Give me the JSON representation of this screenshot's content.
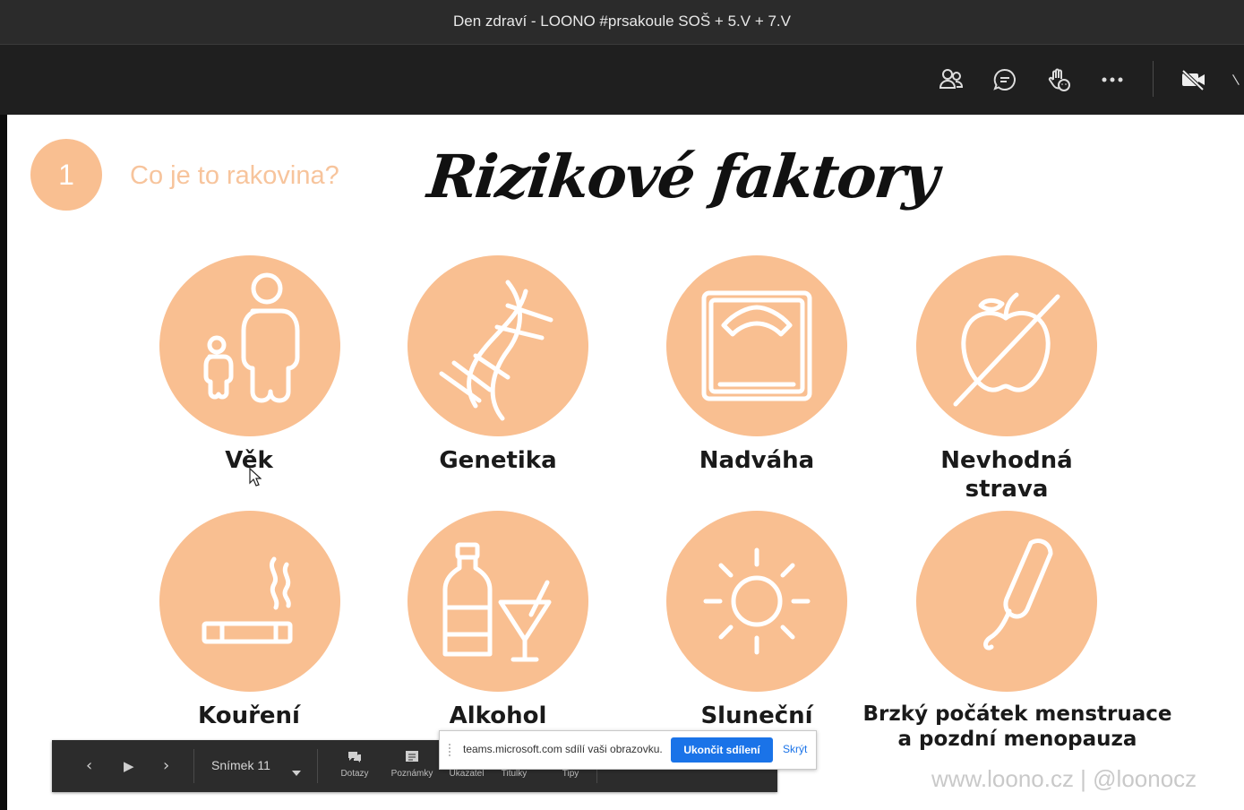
{
  "window": {
    "title": "Den zdraví - LOONO #prsakoule SOŠ + 5.V + 7.V"
  },
  "toolbar": {
    "icons": [
      "people-icon",
      "chat-icon",
      "raise-hand-icon",
      "more-options-icon",
      "camera-off-icon",
      "leave-icon"
    ]
  },
  "slide": {
    "section_number": "1",
    "section_title": "Co je to rakovina?",
    "heading": "Rizikové faktory",
    "accent_color": "#f9bf91",
    "factors": [
      {
        "label": "Věk",
        "icon": "age-icon"
      },
      {
        "label": "Genetika",
        "icon": "dna-icon"
      },
      {
        "label": "Nadváha",
        "icon": "scale-icon"
      },
      {
        "label": "Nevhodná strava",
        "line1": "Nevhodná",
        "line2": "strava",
        "icon": "crossed-apple-icon"
      },
      {
        "label": "Kouření",
        "icon": "cigarette-icon"
      },
      {
        "label": "Alkohol",
        "icon": "alcohol-icon"
      },
      {
        "label": "Sluneční",
        "icon": "sun-icon"
      },
      {
        "label": "Brzký počátek menstruace a pozdní menopauza",
        "line1": "Brzký počátek menstruace",
        "line2": "a pozdní menopauza",
        "icon": "tampon-icon"
      }
    ],
    "credit": "www.loono.cz  |  @loonocz"
  },
  "presenter_bar": {
    "prev": "‹",
    "play": "▶",
    "next": "›",
    "slide_label": "Snímek 11",
    "tools": [
      "Dotazy",
      "Poznámky",
      "Ukazatel",
      "Titulky",
      "Tipy"
    ]
  },
  "share_banner": {
    "message": "teams.microsoft.com sdílí vaši obrazovku.",
    "stop_button": "Ukončit sdílení",
    "hide_link": "Skrýt"
  }
}
